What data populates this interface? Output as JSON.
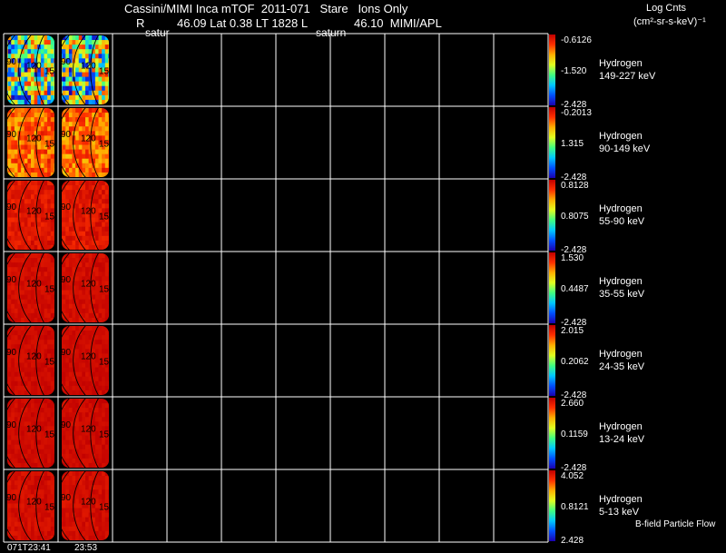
{
  "header": {
    "line1": "Cassini/MIMI Inca mTOF  2011-071   Stare   Ions Only",
    "line2_r": "R",
    "line2_rest": "46.09 Lat 0.38 LT 1828 L",
    "line2_tail": "46.10  MIMI/APL",
    "frame_label_1": "satur",
    "frame_label_2": "saturn",
    "units_title": "Log Cnts",
    "units": "(cm²-sr-s-keV)⁻¹"
  },
  "footer": {
    "time_1": "071T23:41",
    "time_2": "23:53",
    "flow_label": "B-field Particle Flow"
  },
  "chart_data": {
    "type": "heatmap",
    "title": "Cassini/MIMI Inca mTOF  2011-071   Stare   Ions Only",
    "columns": 10,
    "filled_columns": 2,
    "contour_labels": [
      "90",
      "120",
      "150"
    ],
    "grid": true,
    "colors": {
      "background": "#000000",
      "grid": "#ffffff",
      "colorbar_stops": [
        "#1a00b0",
        "#0050ff",
        "#00c8ff",
        "#40ff80",
        "#e0ff20",
        "#ffb000",
        "#ff3000",
        "#c00000"
      ]
    },
    "channels": [
      {
        "species": "Hydrogen",
        "energy": "149-227 keV",
        "cbar_max": "-0.6126",
        "cbar_mid": "-1.520",
        "cbar_min": "-2.428"
      },
      {
        "species": "Hydrogen",
        "energy": "90-149 keV",
        "cbar_max": "-0.2013",
        "cbar_mid": "1.315",
        "cbar_min": "-2.428"
      },
      {
        "species": "Hydrogen",
        "energy": "55-90 keV",
        "cbar_max": "0.8128",
        "cbar_mid": "0.8075",
        "cbar_min": "-2.428"
      },
      {
        "species": "Hydrogen",
        "energy": "35-55 keV",
        "cbar_max": "1.530",
        "cbar_mid": "0.4487",
        "cbar_min": "-2.428"
      },
      {
        "species": "Hydrogen",
        "energy": "24-35 keV",
        "cbar_max": "2.015",
        "cbar_mid": "0.2062",
        "cbar_min": "-2.428"
      },
      {
        "species": "Hydrogen",
        "energy": "13-24 keV",
        "cbar_max": "2.660",
        "cbar_mid": "0.1159",
        "cbar_min": "-2.428"
      },
      {
        "species": "Hydrogen",
        "energy": "5-13 keV",
        "cbar_max": "4.052",
        "cbar_mid": "0.8121",
        "cbar_min": "2.428"
      }
    ],
    "panel_levels": [
      {
        "mean": 0.45,
        "spread": 0.42
      },
      {
        "mean": 0.8,
        "spread": 0.12
      },
      {
        "mean": 0.93,
        "spread": 0.05
      },
      {
        "mean": 0.96,
        "spread": 0.03
      },
      {
        "mean": 0.97,
        "spread": 0.025
      },
      {
        "mean": 0.97,
        "spread": 0.025
      },
      {
        "mean": 0.96,
        "spread": 0.03
      }
    ]
  }
}
